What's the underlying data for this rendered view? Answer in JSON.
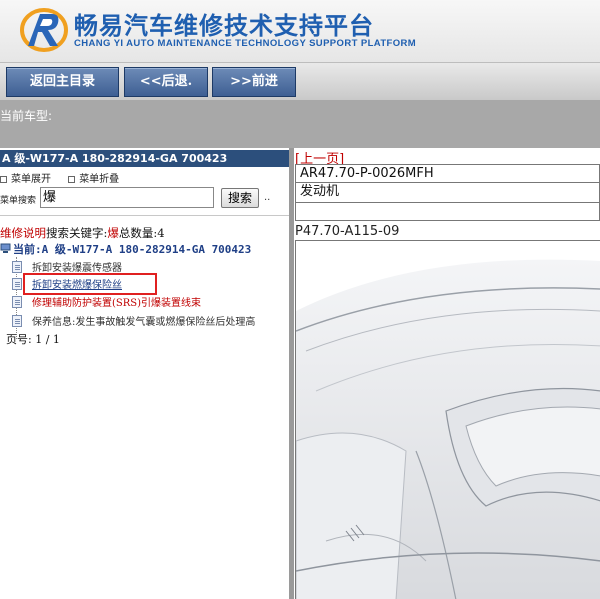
{
  "header": {
    "title": "畅易汽车维修技术支持平台",
    "subtitle": "CHANG YI AUTO MAINTENANCE TECHNOLOGY SUPPORT PLATFORM",
    "brand_color": "#1f5fb0"
  },
  "nav": {
    "home_label": "返回主目录",
    "back_label": "<<后退.",
    "forward_label": ">>前进"
  },
  "model_band": {
    "label": "当前车型:"
  },
  "left_panel": {
    "header": "A 级-W177-A 180-282914-GA 700423",
    "menu_expand": "菜单展开",
    "menu_collapse": "菜单折叠",
    "search_label": "菜单搜索",
    "search_value": "爆",
    "search_button": "搜索",
    "search_more": "..",
    "result_prefix": "维修说明",
    "result_mid": "搜索关键字:",
    "result_keyword": "爆",
    "result_count_label": "总数量:",
    "result_count": "4",
    "current_label": "当前:A 级-W177-A 180-282914-GA 700423",
    "tree_items": [
      "拆卸安装爆震传感器",
      "拆卸安装燃爆保险丝",
      "修理辅助防护装置(SRS)引爆装置线束",
      "保养信息:发生事故触发气囊或燃爆保险丝后处理高"
    ],
    "page_label": "页号:",
    "page_value": "1 / 1"
  },
  "right_panel": {
    "prev_link": "[上一页]",
    "doc_code": "AR47.70-P-0026MFH",
    "doc_title": "发动机",
    "figure_code": "P47.70-A115-09"
  },
  "colors": {
    "panel_header": "#2c4f7c",
    "nav_button": "#4d6d9f",
    "highlight": "#e02020",
    "red_text": "#c00000"
  }
}
